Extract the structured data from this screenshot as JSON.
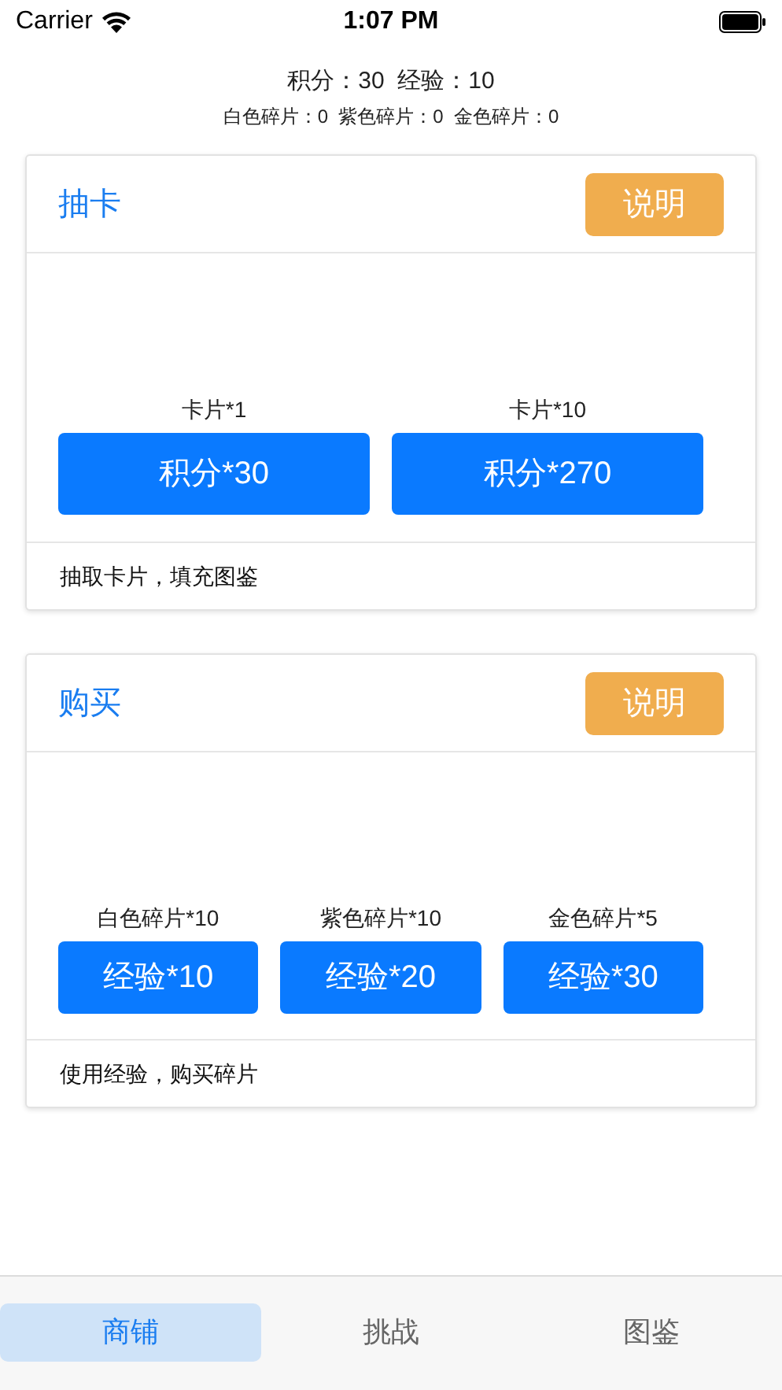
{
  "status_bar": {
    "carrier": "Carrier",
    "time": "1:07 PM"
  },
  "stats": {
    "line_1": "积分：30  经验：10",
    "line_2": "白色碎片：0  紫色碎片：0  金色碎片：0"
  },
  "sections": [
    {
      "title": "抽卡",
      "help_button": "说明",
      "options": [
        {
          "label": "卡片*1",
          "button": "积分*30"
        },
        {
          "label": "卡片*10",
          "button": "积分*270"
        }
      ],
      "footer": "抽取卡片，填充图鉴"
    },
    {
      "title": "购买",
      "help_button": "说明",
      "options": [
        {
          "label": "白色碎片*10",
          "button": "经验*10"
        },
        {
          "label": "紫色碎片*10",
          "button": "经验*20"
        },
        {
          "label": "金色碎片*5",
          "button": "经验*30"
        }
      ],
      "footer": "使用经验，购买碎片"
    }
  ],
  "tabs": [
    {
      "label": "商铺",
      "selected": true
    },
    {
      "label": "挑战",
      "selected": false
    },
    {
      "label": "图鉴",
      "selected": false
    }
  ]
}
